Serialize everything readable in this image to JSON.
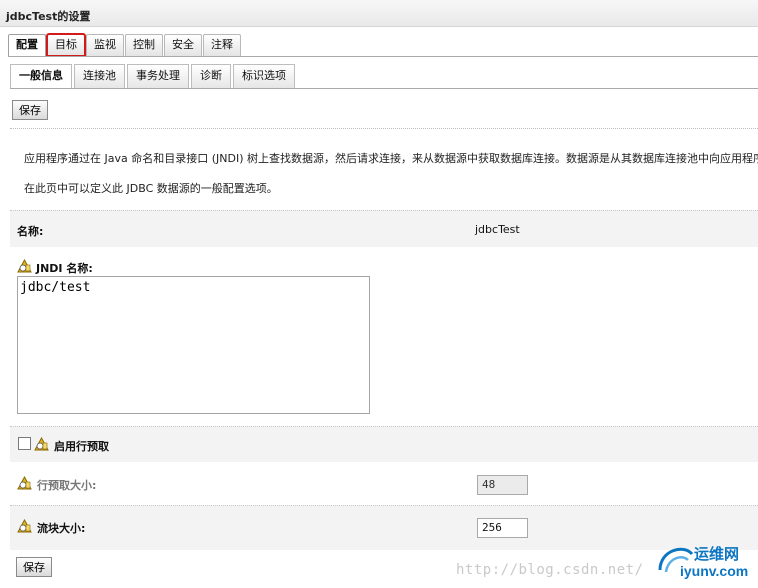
{
  "window": {
    "title": "jdbcTest的设置"
  },
  "tabs": [
    "配置",
    "目标",
    "监视",
    "控制",
    "安全",
    "注释"
  ],
  "subtabs": [
    "一般信息",
    "连接池",
    "事务处理",
    "诊断",
    "标识选项"
  ],
  "buttons": {
    "save_top": "保存",
    "save_bottom": "保存"
  },
  "description": {
    "line1": "应用程序通过在 Java 命名和目录接口 (JNDI) 树上查找数据源，然后请求连接，来从数据源中获取数据库连接。数据源是从其数据库连接池中向应用程序提",
    "line2": "在此页中可以定义此 JDBC 数据源的一般配置选项。"
  },
  "form": {
    "name_label": "名称:",
    "name_value": "jdbcTest",
    "jndi_label": "JNDI 名称:",
    "jndi_value": "jdbc/test",
    "row_prefetch_label": "启用行预取",
    "row_prefetch_size_label": "行预取大小:",
    "row_prefetch_size_value": "48",
    "stream_chunk_label": "流块大小:",
    "stream_chunk_value": "256"
  },
  "watermark": {
    "url": "http://blog.csdn.net/",
    "brand_cn": "运维网",
    "brand_en": "iyunv.com"
  },
  "colors": {
    "highlight": "#d21a1a",
    "warn_icon": "#e0b320",
    "watermark_blue": "#0d76c2"
  }
}
